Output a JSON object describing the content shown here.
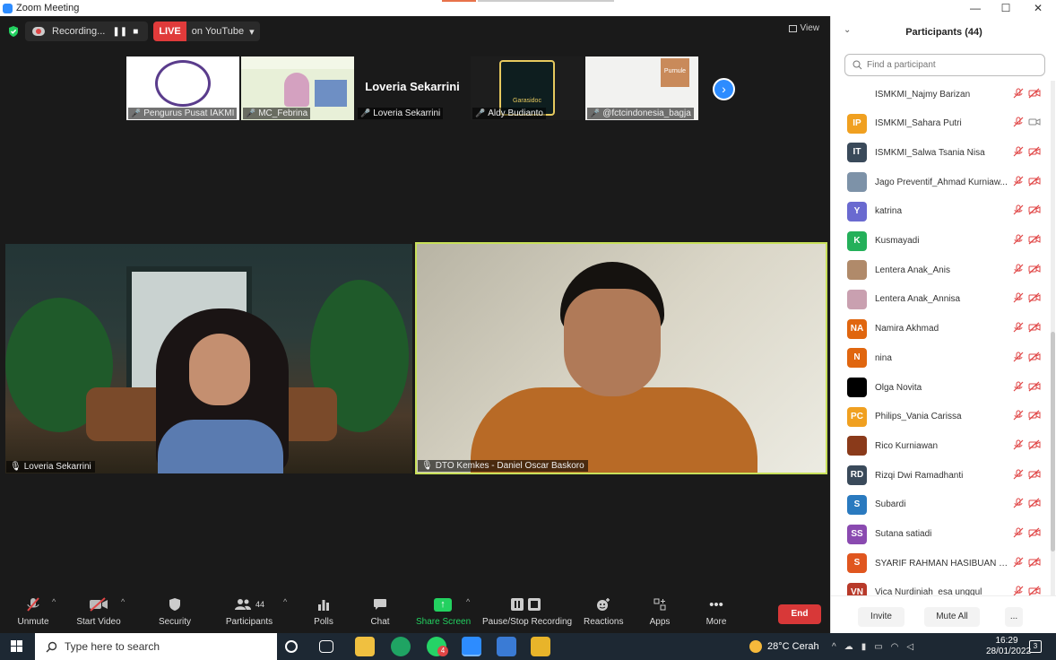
{
  "window": {
    "title": "Zoom Meeting",
    "min": "—",
    "max": "☐",
    "close": "✕"
  },
  "topbar": {
    "recording_label": "Recording...",
    "pause": "❚❚",
    "stop": "■",
    "live_badge": "LIVE",
    "live_target": "on YouTube",
    "live_caret": "▾",
    "view_label": "View"
  },
  "strip": [
    {
      "name": "Pengurus Pusat IAKMI"
    },
    {
      "name": "MC_Febrina"
    },
    {
      "name": "Loveria Sekarrini",
      "display_text": "Loveria Sekarrini"
    },
    {
      "name": "Aldy Budianto",
      "logo_text": "Garasidoc"
    },
    {
      "name": "fctcindonesia_bagja",
      "prefix": "@",
      "poster_text": "Purnule"
    }
  ],
  "videos": {
    "main_left": {
      "name": "Loveria Sekarrini"
    },
    "main_right": {
      "name": "DTO Kemkes - Daniel Oscar Baskoro"
    }
  },
  "toolbar": {
    "unmute": "Unmute",
    "start_video": "Start Video",
    "security": "Security",
    "participants": "Participants",
    "participants_count": "44",
    "polls": "Polls",
    "chat": "Chat",
    "share_screen": "Share Screen",
    "pause_stop_recording": "Pause/Stop Recording",
    "reactions": "Reactions",
    "apps": "Apps",
    "more": "More",
    "end": "End",
    "caret": "^"
  },
  "panel": {
    "title": "Participants (44)",
    "search_placeholder": "Find a participant",
    "participants": [
      {
        "initials": "",
        "name": "ISMKMI_Najmy Barizan",
        "color": "#ffffff",
        "cam": "off"
      },
      {
        "initials": "IP",
        "name": "ISMKMI_Sahara Putri",
        "color": "#f0a020",
        "cam": "on"
      },
      {
        "initials": "IT",
        "name": "ISMKMI_Salwa Tsania Nisa",
        "color": "#3a4a5a",
        "cam": "off"
      },
      {
        "initials": "",
        "name": "Jago Preventif_Ahmad Kurniaw...",
        "color": "#7d92a8",
        "cam": "off"
      },
      {
        "initials": "Y",
        "name": "katrina",
        "color": "#6a6ad0",
        "cam": "off"
      },
      {
        "initials": "K",
        "name": "Kusmayadi",
        "color": "#24b05a",
        "cam": "off"
      },
      {
        "initials": "",
        "name": "Lentera Anak_Anis",
        "color": "#b08a6a",
        "cam": "off"
      },
      {
        "initials": "",
        "name": "Lentera Anak_Annisa",
        "color": "#c9a0b0",
        "cam": "off"
      },
      {
        "initials": "NA",
        "name": "Namira Akhmad",
        "color": "#e0660f",
        "cam": "off"
      },
      {
        "initials": "N",
        "name": "nina",
        "color": "#e0660f",
        "cam": "off"
      },
      {
        "initials": "",
        "name": "Olga Novita",
        "color": "#000000",
        "cam": "off"
      },
      {
        "initials": "PC",
        "name": "Philips_Vania Carissa",
        "color": "#f0a020",
        "cam": "off"
      },
      {
        "initials": "",
        "name": "Rico Kurniawan",
        "color": "#8a3a1a",
        "cam": "off"
      },
      {
        "initials": "RD",
        "name": "Rizqi Dwi Ramadhanti",
        "color": "#3a4a5a",
        "cam": "off"
      },
      {
        "initials": "S",
        "name": "Subardi",
        "color": "#2a7abf",
        "cam": "off"
      },
      {
        "initials": "SS",
        "name": "Sutana satiadi",
        "color": "#8a4ab0",
        "cam": "off"
      },
      {
        "initials": "S",
        "name": "SYARIF RAHMAN HASIBUAN 1...",
        "color": "#e0561f",
        "cam": "off"
      },
      {
        "initials": "VN",
        "name": "Vica Nurdiniah_esa unggul",
        "color": "#b83a2a",
        "cam": "off"
      }
    ],
    "invite": "Invite",
    "mute_all": "Mute All",
    "more": "..."
  },
  "taskbar": {
    "search_placeholder": "Type here to search",
    "weather": "28°C  Cerah",
    "time": "16:29",
    "date": "28/01/2022",
    "notifications": "3",
    "badge_count": "4"
  }
}
